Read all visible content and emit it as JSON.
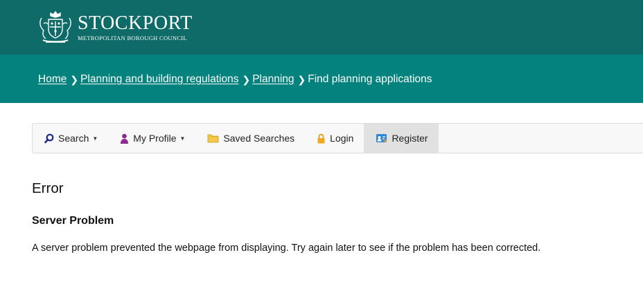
{
  "header": {
    "logo_name": "STOCKPORT",
    "logo_subtitle": "METROPOLITAN BOROUGH COUNCIL",
    "colors": {
      "header_bg": "#0e6b67",
      "breadcrumb_bg": "#04827d"
    }
  },
  "breadcrumb": {
    "items": [
      {
        "label": "Home",
        "link": true
      },
      {
        "label": "Planning and building regulations",
        "link": true
      },
      {
        "label": "Planning",
        "link": true
      },
      {
        "label": "Find planning applications",
        "link": false
      }
    ],
    "separator_icon": "chevron-right-icon"
  },
  "nav": {
    "search": {
      "label": "Search",
      "icon": "search-icon"
    },
    "profile": {
      "label": "My Profile",
      "icon": "person-icon"
    },
    "saved": {
      "label": "Saved Searches",
      "icon": "folder-icon"
    },
    "login": {
      "label": "Login",
      "icon": "lock-icon"
    },
    "register": {
      "label": "Register",
      "icon": "register-card-icon"
    }
  },
  "content": {
    "title": "Error",
    "subtitle": "Server Problem",
    "message": "A server problem prevented the webpage from displaying. Try again later to see if the problem has been corrected."
  }
}
